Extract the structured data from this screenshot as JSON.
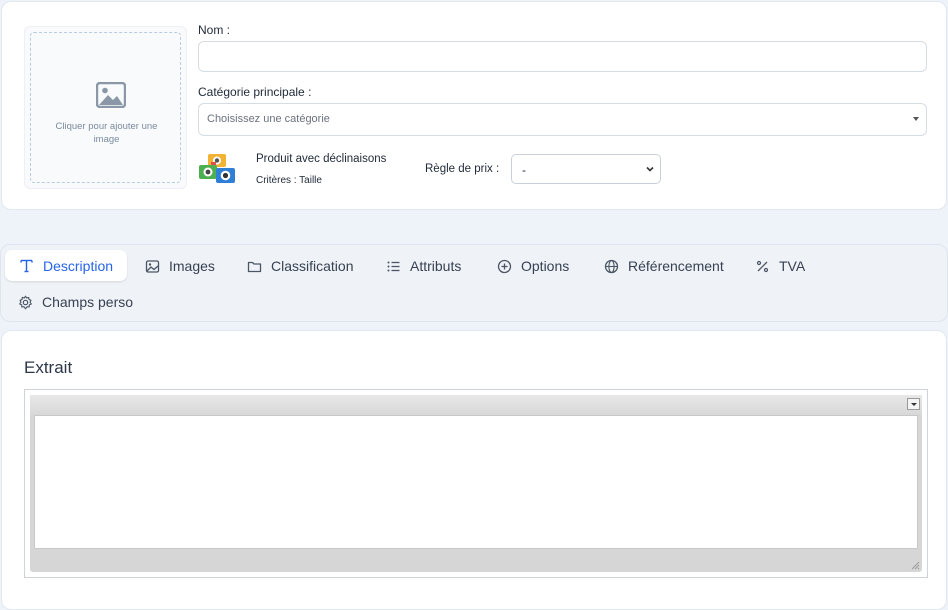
{
  "product": {
    "image_hint": "Cliquer pour ajouter une image",
    "name_label": "Nom :",
    "name_value": "",
    "category_label": "Catégorie principale :",
    "category_placeholder": "Choisissez une catégorie",
    "variants_title": "Produit avec déclinaisons",
    "variants_criteria": "Critères : Taille",
    "price_rule_label": "Règle de prix :",
    "price_rule_value": "-"
  },
  "tabs": [
    {
      "label": "Description",
      "icon": "text-icon",
      "active": true
    },
    {
      "label": "Images",
      "icon": "image-icon"
    },
    {
      "label": "Classification",
      "icon": "folder-icon"
    },
    {
      "label": "Attributs",
      "icon": "list-icon"
    },
    {
      "label": "Options",
      "icon": "plus-circle-icon"
    },
    {
      "label": "Référencement",
      "icon": "globe-icon"
    },
    {
      "label": "TVA",
      "icon": "percent-icon"
    },
    {
      "label": "Champs perso",
      "icon": "gear-icon"
    }
  ],
  "description": {
    "section_title": "Extrait",
    "editor_content": ""
  },
  "colors": {
    "accent": "#2563eb",
    "page_bg": "#eef2f9"
  }
}
